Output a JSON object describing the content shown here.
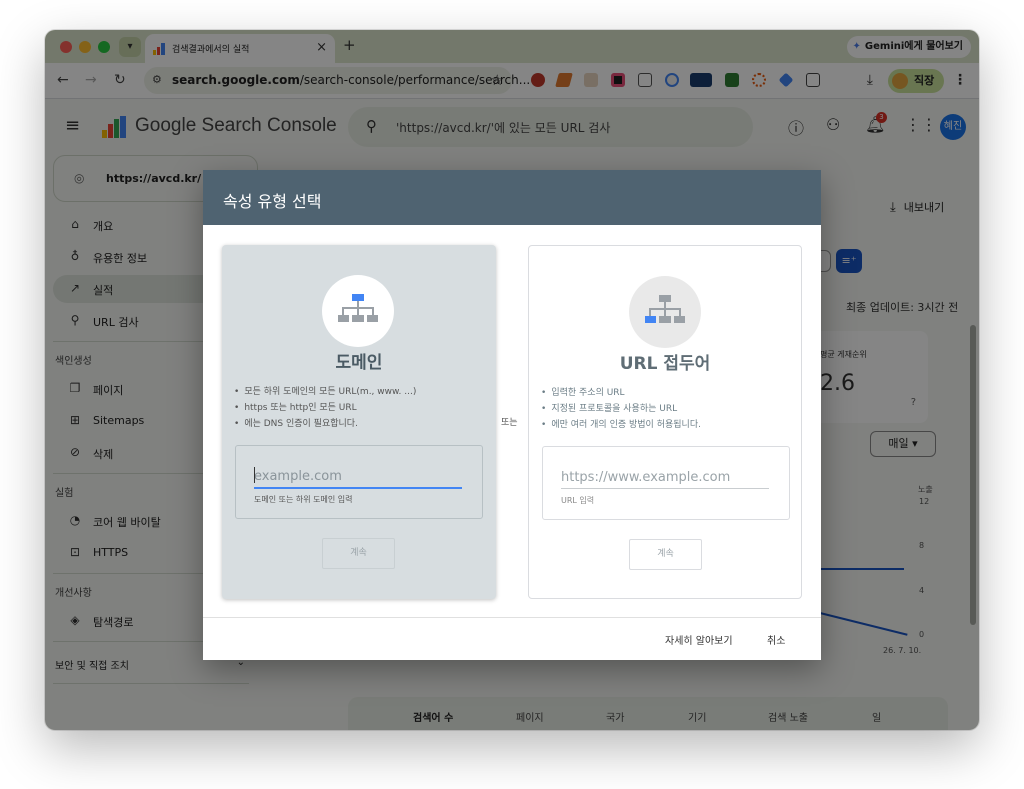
{
  "browser": {
    "tab_title": "검색결과에서의 실적",
    "tab_close": "×",
    "new_tab": "+",
    "gemini_label": "Gemini에게 물어보기",
    "url_host": "search.google.com",
    "url_path": "/search-console/performance/search...",
    "profile_label": "직장"
  },
  "app": {
    "logo_text": "Google Search Console",
    "search_placeholder": "'https://avcd.kr/'에 있는 모든 URL 검사",
    "notification_count": "3",
    "user_initials": "혜진",
    "property": "https://avcd.kr/",
    "export_label": "내보내기"
  },
  "sidebar": {
    "items_top": [
      {
        "label": "개요",
        "icon": "home-icon"
      },
      {
        "label": "유용한 정보",
        "icon": "lightbulb-icon"
      },
      {
        "label": "실적",
        "icon": "trending-up-icon"
      },
      {
        "label": "URL 검사",
        "icon": "search-icon"
      }
    ],
    "section_indexing": "색인생성",
    "items_indexing": [
      {
        "label": "페이지",
        "icon": "pages-icon"
      },
      {
        "label": "Sitemaps",
        "icon": "sitemap-icon"
      },
      {
        "label": "삭제",
        "icon": "eye-off-icon"
      }
    ],
    "section_experience": "실험",
    "items_experience": [
      {
        "label": "코어 웹 바이탈",
        "icon": "gauge-icon"
      },
      {
        "label": "HTTPS",
        "icon": "lock-icon"
      }
    ],
    "section_improvements": "개선사항",
    "items_improvements": [
      {
        "label": "탐색경로",
        "icon": "layers-icon"
      }
    ],
    "security_label": "보안 및 직접 조치"
  },
  "main": {
    "last_updated": "최종 업데이트: 3시간 전",
    "metric_label": "평균 게재순위",
    "metric_value": "2.6",
    "period_button": "매일",
    "chart_axis_title": "노출",
    "chart_ticks": [
      "12",
      "8",
      "4",
      "0"
    ],
    "chart_date": "26. 7. 10.",
    "bottom_tabs": [
      "검색어 수",
      "페이지",
      "국가",
      "기기",
      "검색 노출",
      "일"
    ]
  },
  "modal": {
    "title": "속성 유형 선택",
    "or_label": "또는",
    "domain": {
      "title": "도메인",
      "bullets": [
        "모든 하위 도메인의 모든 URL(m., www. ...)",
        "https 또는 http인 모든 URL",
        "에는 DNS 인증이 필요합니다."
      ],
      "placeholder": "example.com",
      "help": "도메인 또는 하위 도메인 입력",
      "continue": "계속"
    },
    "url_prefix": {
      "title": "URL 접두어",
      "bullets": [
        "입력한 주소의 URL",
        "지정된 프로토콜을 사용하는 URL",
        "에만 여러 개의 인증 방법이 허용됩니다."
      ],
      "placeholder": "https://www.example.com",
      "help": "URL 입력",
      "continue": "계속"
    },
    "learn_more": "자세히 알아보기",
    "cancel": "취소"
  },
  "colors": {
    "modal_header": "#4f6371",
    "accent_blue": "#4285f4",
    "domain_card_bg": "#d7dde0"
  }
}
